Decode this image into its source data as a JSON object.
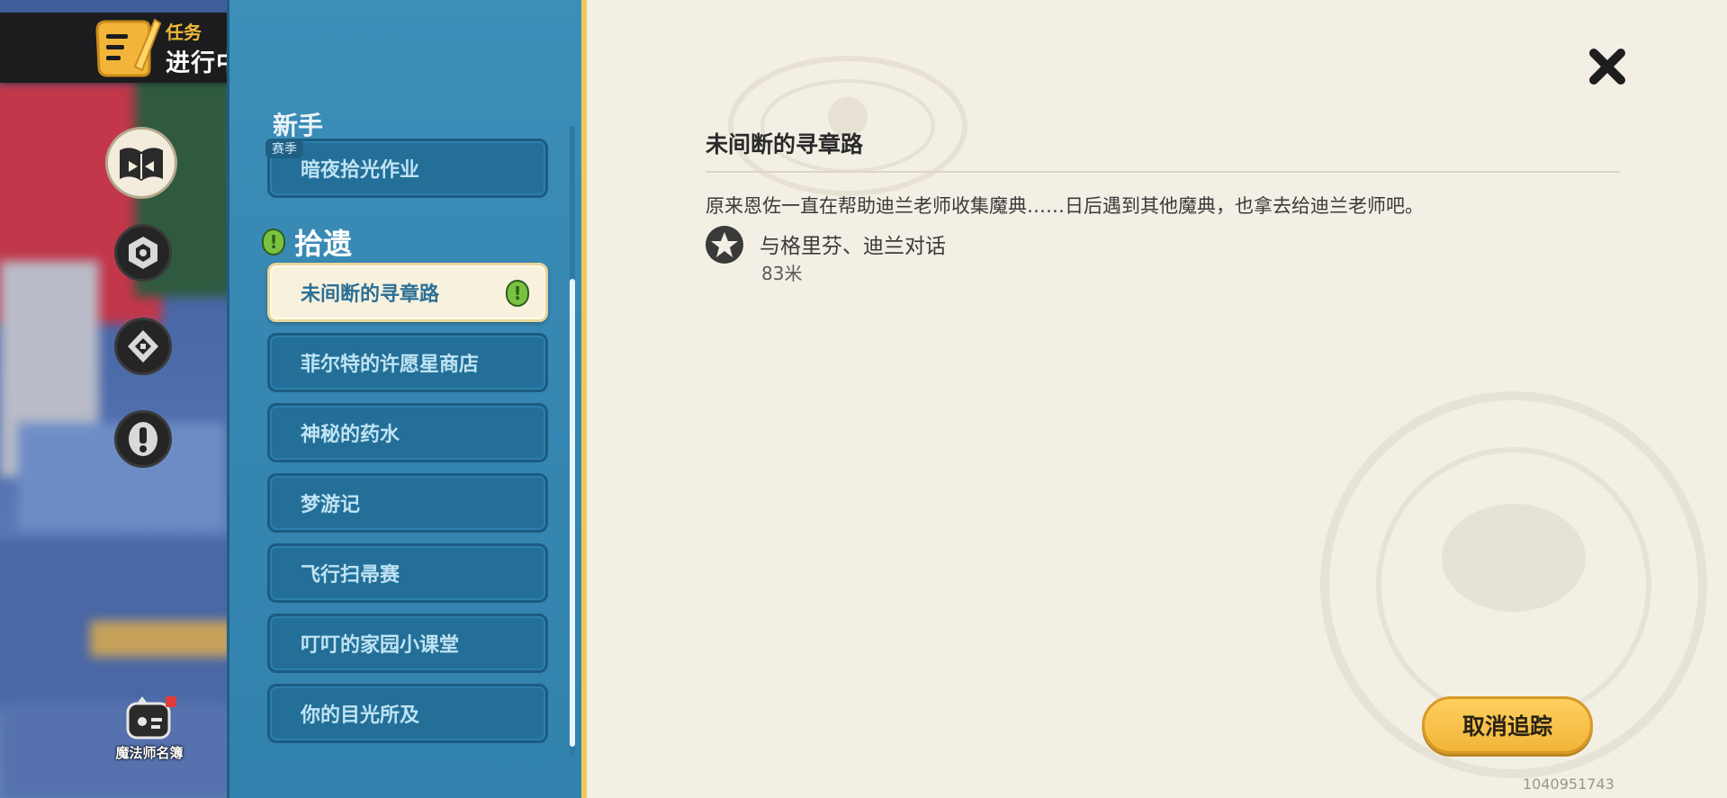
{
  "banner": {
    "title": "任务",
    "status": "进行中"
  },
  "left_nav": {
    "mage_roster_label": "魔法师名簿"
  },
  "quest_list": {
    "season_tag": "赛季",
    "season_section": "新手",
    "season_items": [
      {
        "label": "暗夜拾光作业"
      }
    ],
    "misc_section": "拾遗",
    "misc_items": [
      {
        "label": "未间断的寻章路",
        "active": true
      },
      {
        "label": "菲尔特的许愿星商店"
      },
      {
        "label": "神秘的药水"
      },
      {
        "label": "梦游记"
      },
      {
        "label": "飞行扫帚赛"
      },
      {
        "label": "叮叮的家园小课堂"
      },
      {
        "label": "你的目光所及"
      }
    ]
  },
  "detail": {
    "title": "未间断的寻章路",
    "description": "原来恩佐一直在帮助迪兰老师收集魔典……日后遇到其他魔典，也拿去给迪兰老师吧。",
    "objective": "与格里芬、迪兰对话",
    "distance": "83米",
    "untrack_button": "取消追踪",
    "uid": "1040951743"
  },
  "colors": {
    "panel_blue": "#3587b2",
    "detail_bg": "#f3efe4",
    "accent_yellow": "#f2b53a",
    "alert_green": "#7cc242"
  }
}
